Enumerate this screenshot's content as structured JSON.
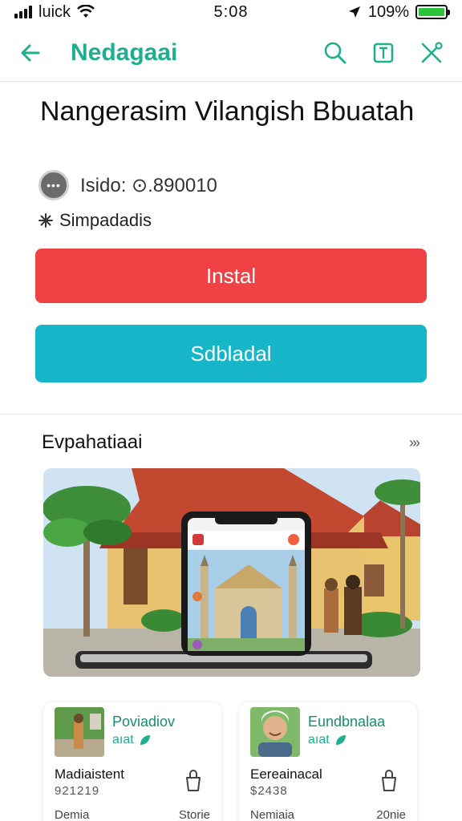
{
  "status_bar": {
    "carrier": "luick",
    "time": "5:08",
    "battery": "109%",
    "battery_level": 1.0,
    "battery_color": "#2ec33a"
  },
  "app_bar": {
    "title": "Nedagaai",
    "accent_color": "#1fae8e",
    "icons": [
      "back-arrow-icon",
      "search-icon",
      "bookmark-icon",
      "share-icon"
    ]
  },
  "header": {
    "title": "Nangerasim Vilangish Bbuatah",
    "meta": "Isido: ⊙.890010",
    "tag": "Simpadadis"
  },
  "buttons": {
    "install": "Instal",
    "install_color": "#f04145",
    "download": "Sdbladal",
    "download_color": "#17b5c8"
  },
  "section": {
    "title": "Evpahatiaai",
    "more": "›››"
  },
  "cards": [
    {
      "title": "Poviadiov",
      "badge": "aıat",
      "name": "Madiaistent",
      "price": "921219",
      "footer_left": "Demia",
      "footer_right": "Storie"
    },
    {
      "title": "Eundbnalaa",
      "badge": "aıat",
      "name": "Eereainacal",
      "price": "$2438",
      "footer_left": "Nemiaia",
      "footer_right": "20nie"
    }
  ]
}
